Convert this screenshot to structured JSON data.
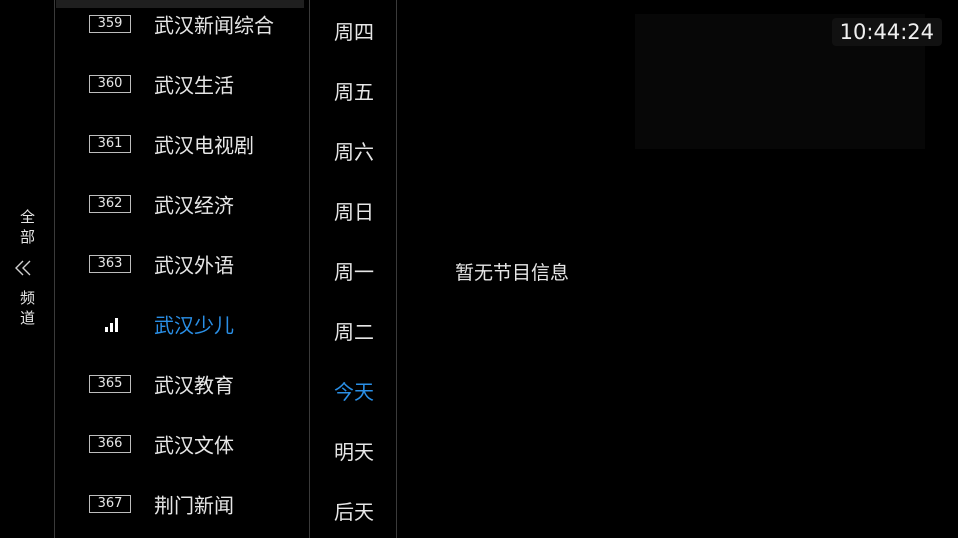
{
  "sidebar": {
    "label_top": [
      "全",
      "部"
    ],
    "label_bottom": [
      "频",
      "道"
    ],
    "icon": "double-chevron-left-icon"
  },
  "channels": [
    {
      "number": "359",
      "name": "武汉新闻综合",
      "active": false
    },
    {
      "number": "360",
      "name": "武汉生活",
      "active": false
    },
    {
      "number": "361",
      "name": "武汉电视剧",
      "active": false
    },
    {
      "number": "362",
      "name": "武汉经济",
      "active": false
    },
    {
      "number": "363",
      "name": "武汉外语",
      "active": false
    },
    {
      "number": "",
      "name": "武汉少儿",
      "active": true,
      "icon": "signal-bars-icon"
    },
    {
      "number": "365",
      "name": "武汉教育",
      "active": false
    },
    {
      "number": "366",
      "name": "武汉文体",
      "active": false
    },
    {
      "number": "367",
      "name": "荆门新闻",
      "active": false
    }
  ],
  "days": [
    {
      "label": "周四",
      "active": false
    },
    {
      "label": "周五",
      "active": false
    },
    {
      "label": "周六",
      "active": false
    },
    {
      "label": "周日",
      "active": false
    },
    {
      "label": "周一",
      "active": false
    },
    {
      "label": "周二",
      "active": false
    },
    {
      "label": "今天",
      "active": true
    },
    {
      "label": "明天",
      "active": false
    },
    {
      "label": "后天",
      "active": false
    }
  ],
  "program": {
    "empty_message": "暂无节目信息"
  },
  "clock": {
    "time": "10:44:24"
  },
  "colors": {
    "accent": "#2a8fe6",
    "background": "#000000",
    "text": "#e6e6e6"
  }
}
